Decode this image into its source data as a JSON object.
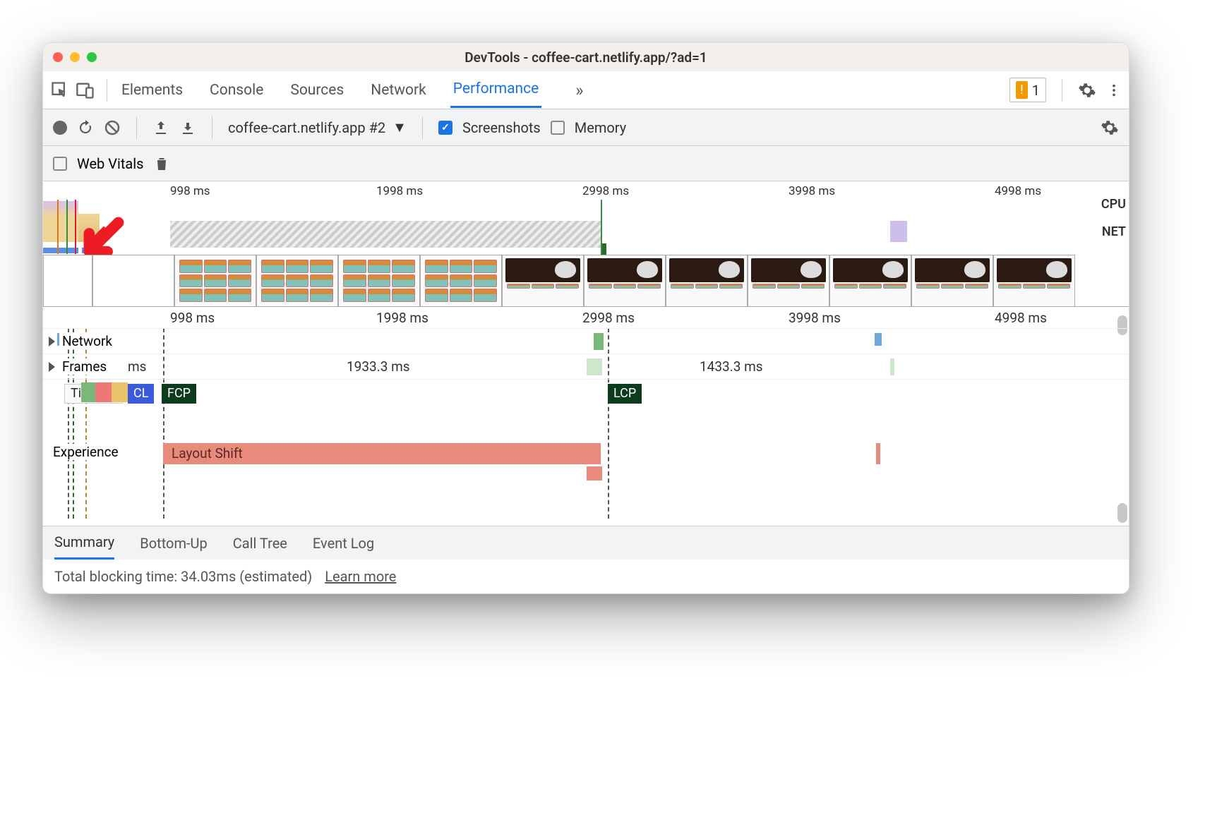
{
  "window": {
    "title": "DevTools - coffee-cart.netlify.app/?ad=1"
  },
  "tabs": {
    "items": [
      "Elements",
      "Console",
      "Sources",
      "Network",
      "Performance"
    ],
    "active": "Performance",
    "overflow": "»",
    "issues_count": "1"
  },
  "toolbar": {
    "recording_label": "coffee-cart.netlify.app #2",
    "screenshots_label": "Screenshots",
    "memory_label": "Memory",
    "screenshots_checked": true,
    "memory_checked": false
  },
  "toolbar2": {
    "web_vitals_label": "Web Vitals"
  },
  "overview": {
    "ticks": [
      "998 ms",
      "1998 ms",
      "2998 ms",
      "3998 ms",
      "4998 ms"
    ],
    "side_labels": [
      "CPU",
      "NET"
    ]
  },
  "detail": {
    "ticks": [
      "998 ms",
      "1998 ms",
      "2998 ms",
      "3998 ms",
      "4998 ms"
    ],
    "tracks": {
      "network": "Network",
      "frames": "Frames",
      "frames_values": [
        "ms",
        "1933.3 ms",
        "1433.3 ms"
      ],
      "timings": "Timings",
      "timings_tags": {
        "cl": "CL",
        "fcp": "FCP",
        "lcp": "LCP"
      },
      "experience": "Experience",
      "layout_shift": "Layout Shift"
    }
  },
  "bottom_tabs": [
    "Summary",
    "Bottom-Up",
    "Call Tree",
    "Event Log"
  ],
  "footer": {
    "tbt": "Total blocking time: 34.03ms (estimated)",
    "learn_more": "Learn more"
  }
}
